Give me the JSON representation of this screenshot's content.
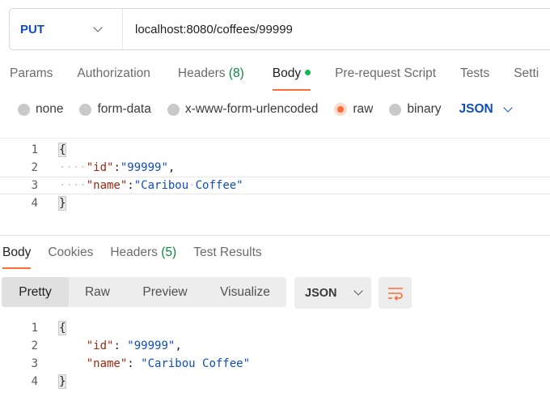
{
  "request": {
    "method": "PUT",
    "url": "localhost:8080/coffees/99999"
  },
  "request_tabs": [
    {
      "label": "Params"
    },
    {
      "label": "Authorization"
    },
    {
      "label": "Headers",
      "count": "(8)"
    },
    {
      "label": "Body"
    },
    {
      "label": "Pre-request Script"
    },
    {
      "label": "Tests"
    },
    {
      "label": "Setti"
    }
  ],
  "body_types": [
    "none",
    "form-data",
    "x-www-form-urlencoded",
    "raw",
    "binary"
  ],
  "body_type_selected": "raw",
  "body_format": "JSON",
  "request_body": {
    "line_numbers": [
      "1",
      "2",
      "3",
      "4"
    ],
    "open_brace": "{",
    "close_brace": "}",
    "key_id": "\"id\"",
    "val_id": "\"99999\"",
    "key_name": "\"name\"",
    "val_name_1": "\"Caribou",
    "val_name_2": "Coffee\""
  },
  "response_tabs": [
    {
      "label": "Body"
    },
    {
      "label": "Cookies"
    },
    {
      "label": "Headers",
      "count": "(5)"
    },
    {
      "label": "Test Results"
    }
  ],
  "response_views": [
    "Pretty",
    "Raw",
    "Preview",
    "Visualize"
  ],
  "response_format": "JSON",
  "response_body": {
    "line_numbers": [
      "1",
      "2",
      "3",
      "4"
    ],
    "open_brace": "{",
    "close_brace": "}",
    "key_id": "\"id\"",
    "val_id": "\"99999\"",
    "key_name": "\"name\"",
    "val_name": "\"Caribou Coffee\""
  },
  "colors": {
    "accent": "#ff6c37",
    "method": "#0e4dbf",
    "count": "#0a8a3a",
    "body_dot": "#0cbb52",
    "json_key": "#a1260d",
    "json_string": "#0e4dbf"
  }
}
